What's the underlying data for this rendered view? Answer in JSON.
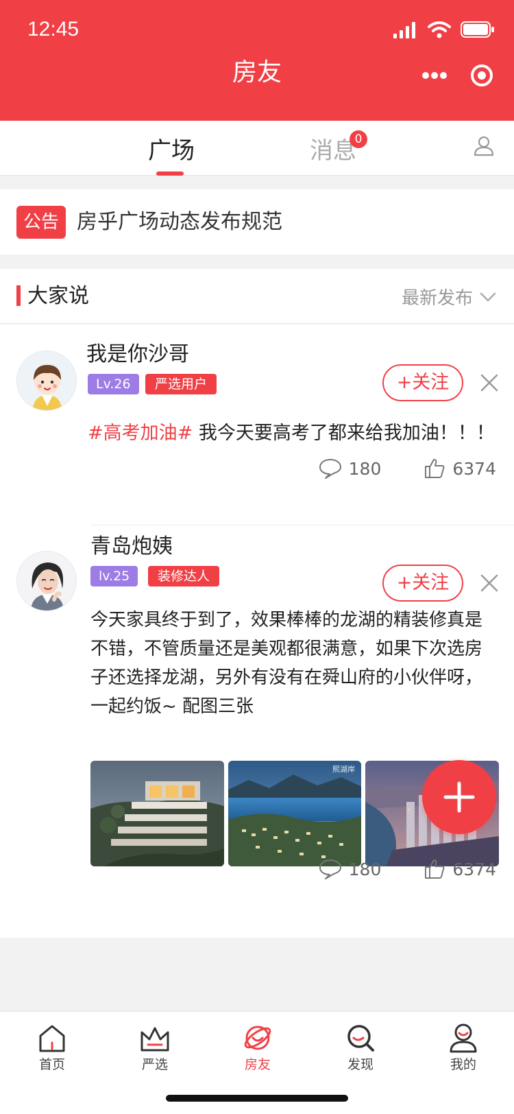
{
  "status_bar": {
    "time": "12:45"
  },
  "nav": {
    "title": "房友"
  },
  "tabs": {
    "square_label": "广场",
    "messages_label": "消息",
    "messages_badge": "0"
  },
  "notice": {
    "tag": "公告",
    "text": "房乎广场动态发布规范"
  },
  "section": {
    "title": "大家说",
    "sort_label": "最新发布"
  },
  "posts": [
    {
      "username": "我是你沙哥",
      "level": "Lv.26",
      "role": "严选用户",
      "follow_label": "+关注",
      "hashtag": "#高考加油#",
      "text": " 我今天要高考了都来给我加油！！！",
      "comments": "180",
      "likes": "6374"
    },
    {
      "username": "青岛炮姨",
      "level": "lv.25",
      "role": "装修达人",
      "follow_label": "+关注",
      "text": "今天家具终于到了，效果棒棒的龙湖的精装修真是不错，不管质量还是美观都很满意，如果下次选房子还选择龙湖，另外有没有在舜山府的小伙伴呀，一起约饭~      配图三张",
      "photo_watermark": "熙湖岸",
      "comments": "180",
      "likes": "6374"
    }
  ],
  "tabbar": {
    "items": [
      {
        "label": "首页",
        "icon": "home-icon"
      },
      {
        "label": "严选",
        "icon": "crown-icon"
      },
      {
        "label": "房友",
        "icon": "planet-icon"
      },
      {
        "label": "发现",
        "icon": "search-icon"
      },
      {
        "label": "我的",
        "icon": "user-icon"
      }
    ]
  },
  "colors": {
    "primary": "#f04046",
    "level_badge": "#9d7ce6"
  }
}
